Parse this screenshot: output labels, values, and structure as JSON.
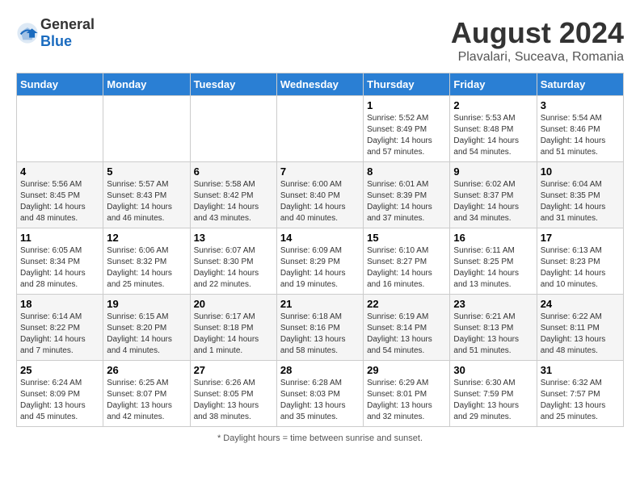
{
  "header": {
    "logo_general": "General",
    "logo_blue": "Blue",
    "month_year": "August 2024",
    "location": "Plavalari, Suceava, Romania"
  },
  "footer": {
    "note": "Daylight hours"
  },
  "days_of_week": [
    "Sunday",
    "Monday",
    "Tuesday",
    "Wednesday",
    "Thursday",
    "Friday",
    "Saturday"
  ],
  "weeks": [
    [
      {
        "day": "",
        "info": ""
      },
      {
        "day": "",
        "info": ""
      },
      {
        "day": "",
        "info": ""
      },
      {
        "day": "",
        "info": ""
      },
      {
        "day": "1",
        "info": "Sunrise: 5:52 AM\nSunset: 8:49 PM\nDaylight: 14 hours\nand 57 minutes."
      },
      {
        "day": "2",
        "info": "Sunrise: 5:53 AM\nSunset: 8:48 PM\nDaylight: 14 hours\nand 54 minutes."
      },
      {
        "day": "3",
        "info": "Sunrise: 5:54 AM\nSunset: 8:46 PM\nDaylight: 14 hours\nand 51 minutes."
      }
    ],
    [
      {
        "day": "4",
        "info": "Sunrise: 5:56 AM\nSunset: 8:45 PM\nDaylight: 14 hours\nand 48 minutes."
      },
      {
        "day": "5",
        "info": "Sunrise: 5:57 AM\nSunset: 8:43 PM\nDaylight: 14 hours\nand 46 minutes."
      },
      {
        "day": "6",
        "info": "Sunrise: 5:58 AM\nSunset: 8:42 PM\nDaylight: 14 hours\nand 43 minutes."
      },
      {
        "day": "7",
        "info": "Sunrise: 6:00 AM\nSunset: 8:40 PM\nDaylight: 14 hours\nand 40 minutes."
      },
      {
        "day": "8",
        "info": "Sunrise: 6:01 AM\nSunset: 8:39 PM\nDaylight: 14 hours\nand 37 minutes."
      },
      {
        "day": "9",
        "info": "Sunrise: 6:02 AM\nSunset: 8:37 PM\nDaylight: 14 hours\nand 34 minutes."
      },
      {
        "day": "10",
        "info": "Sunrise: 6:04 AM\nSunset: 8:35 PM\nDaylight: 14 hours\nand 31 minutes."
      }
    ],
    [
      {
        "day": "11",
        "info": "Sunrise: 6:05 AM\nSunset: 8:34 PM\nDaylight: 14 hours\nand 28 minutes."
      },
      {
        "day": "12",
        "info": "Sunrise: 6:06 AM\nSunset: 8:32 PM\nDaylight: 14 hours\nand 25 minutes."
      },
      {
        "day": "13",
        "info": "Sunrise: 6:07 AM\nSunset: 8:30 PM\nDaylight: 14 hours\nand 22 minutes."
      },
      {
        "day": "14",
        "info": "Sunrise: 6:09 AM\nSunset: 8:29 PM\nDaylight: 14 hours\nand 19 minutes."
      },
      {
        "day": "15",
        "info": "Sunrise: 6:10 AM\nSunset: 8:27 PM\nDaylight: 14 hours\nand 16 minutes."
      },
      {
        "day": "16",
        "info": "Sunrise: 6:11 AM\nSunset: 8:25 PM\nDaylight: 14 hours\nand 13 minutes."
      },
      {
        "day": "17",
        "info": "Sunrise: 6:13 AM\nSunset: 8:23 PM\nDaylight: 14 hours\nand 10 minutes."
      }
    ],
    [
      {
        "day": "18",
        "info": "Sunrise: 6:14 AM\nSunset: 8:22 PM\nDaylight: 14 hours\nand 7 minutes."
      },
      {
        "day": "19",
        "info": "Sunrise: 6:15 AM\nSunset: 8:20 PM\nDaylight: 14 hours\nand 4 minutes."
      },
      {
        "day": "20",
        "info": "Sunrise: 6:17 AM\nSunset: 8:18 PM\nDaylight: 14 hours\nand 1 minute."
      },
      {
        "day": "21",
        "info": "Sunrise: 6:18 AM\nSunset: 8:16 PM\nDaylight: 13 hours\nand 58 minutes."
      },
      {
        "day": "22",
        "info": "Sunrise: 6:19 AM\nSunset: 8:14 PM\nDaylight: 13 hours\nand 54 minutes."
      },
      {
        "day": "23",
        "info": "Sunrise: 6:21 AM\nSunset: 8:13 PM\nDaylight: 13 hours\nand 51 minutes."
      },
      {
        "day": "24",
        "info": "Sunrise: 6:22 AM\nSunset: 8:11 PM\nDaylight: 13 hours\nand 48 minutes."
      }
    ],
    [
      {
        "day": "25",
        "info": "Sunrise: 6:24 AM\nSunset: 8:09 PM\nDaylight: 13 hours\nand 45 minutes."
      },
      {
        "day": "26",
        "info": "Sunrise: 6:25 AM\nSunset: 8:07 PM\nDaylight: 13 hours\nand 42 minutes."
      },
      {
        "day": "27",
        "info": "Sunrise: 6:26 AM\nSunset: 8:05 PM\nDaylight: 13 hours\nand 38 minutes."
      },
      {
        "day": "28",
        "info": "Sunrise: 6:28 AM\nSunset: 8:03 PM\nDaylight: 13 hours\nand 35 minutes."
      },
      {
        "day": "29",
        "info": "Sunrise: 6:29 AM\nSunset: 8:01 PM\nDaylight: 13 hours\nand 32 minutes."
      },
      {
        "day": "30",
        "info": "Sunrise: 6:30 AM\nSunset: 7:59 PM\nDaylight: 13 hours\nand 29 minutes."
      },
      {
        "day": "31",
        "info": "Sunrise: 6:32 AM\nSunset: 7:57 PM\nDaylight: 13 hours\nand 25 minutes."
      }
    ]
  ]
}
